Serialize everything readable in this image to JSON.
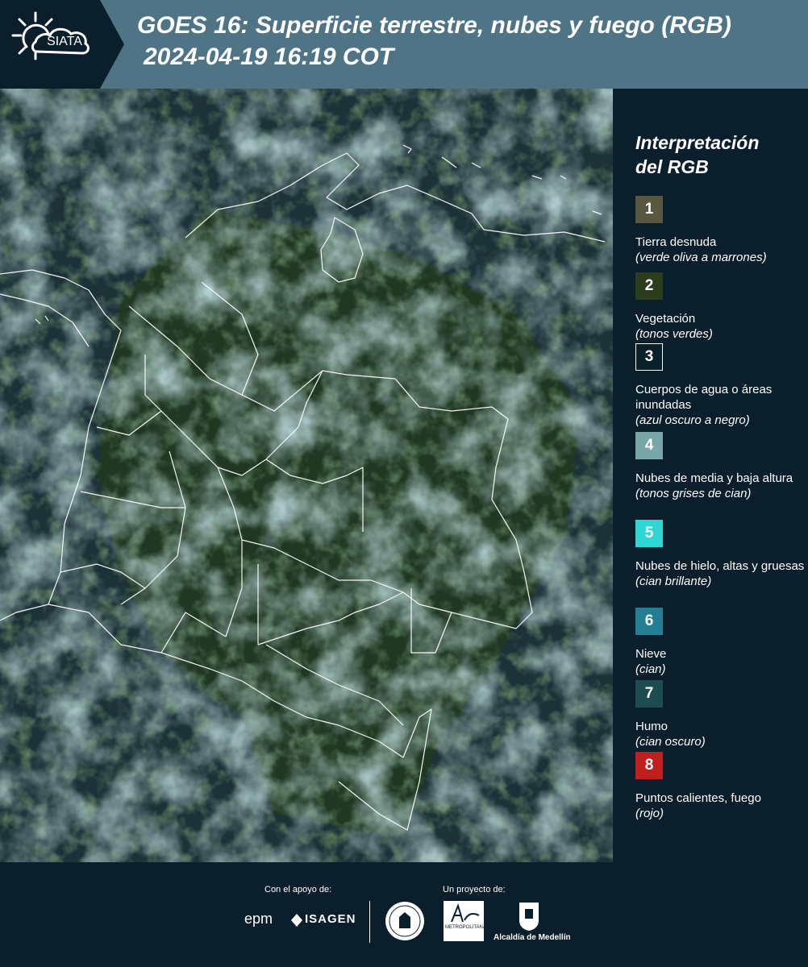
{
  "header": {
    "logo_text": "SIATA",
    "title_line1": "GOES 16: Superficie terrestre, nubes y fuego (RGB)",
    "title_line2": "2024-04-19 16:19 COT"
  },
  "legend": {
    "title_line1": "Interpretación",
    "title_line2": "del RGB",
    "items": [
      {
        "num": "1",
        "color": "#58573f",
        "label": "Tierra desnuda",
        "desc": "(verde oliva a marrones)"
      },
      {
        "num": "2",
        "color": "#2c3d1d",
        "label": "Vegetación",
        "desc": "(tonos verdes)"
      },
      {
        "num": "3",
        "color": "#0b1e2b",
        "label": "Cuerpos de agua o áreas inundadas",
        "desc": "(azul oscuro a negro)"
      },
      {
        "num": "4",
        "color": "#79a6a6",
        "label": "Nubes de media y baja altura",
        "desc": "(tonos grises de cian)"
      },
      {
        "num": "5",
        "color": "#2fd6d4",
        "label": "Nubes de hielo, altas y gruesas",
        "desc": "(cian brillante)"
      },
      {
        "num": "6",
        "color": "#237e93",
        "label": "Nieve",
        "desc": "(cian)"
      },
      {
        "num": "7",
        "color": "#1d4d50",
        "label": "Humo",
        "desc": "(cian oscuro)"
      },
      {
        "num": "8",
        "color": "#c11e1e",
        "label": "Puntos calientes, fuego",
        "desc": "(rojo)"
      }
    ]
  },
  "footer": {
    "support_label": "Con el apoyo de:",
    "project_label": "Un proyecto de:",
    "epm": "epm",
    "isagen": "ISAGEN",
    "area_text": "METROPOLITANA",
    "alcaldia": "Alcaldía de Medellín"
  },
  "colors": {
    "header_bg": "#4f7485",
    "logo_bg": "#0b1e2b",
    "page_bg": "#0b1e2b"
  }
}
